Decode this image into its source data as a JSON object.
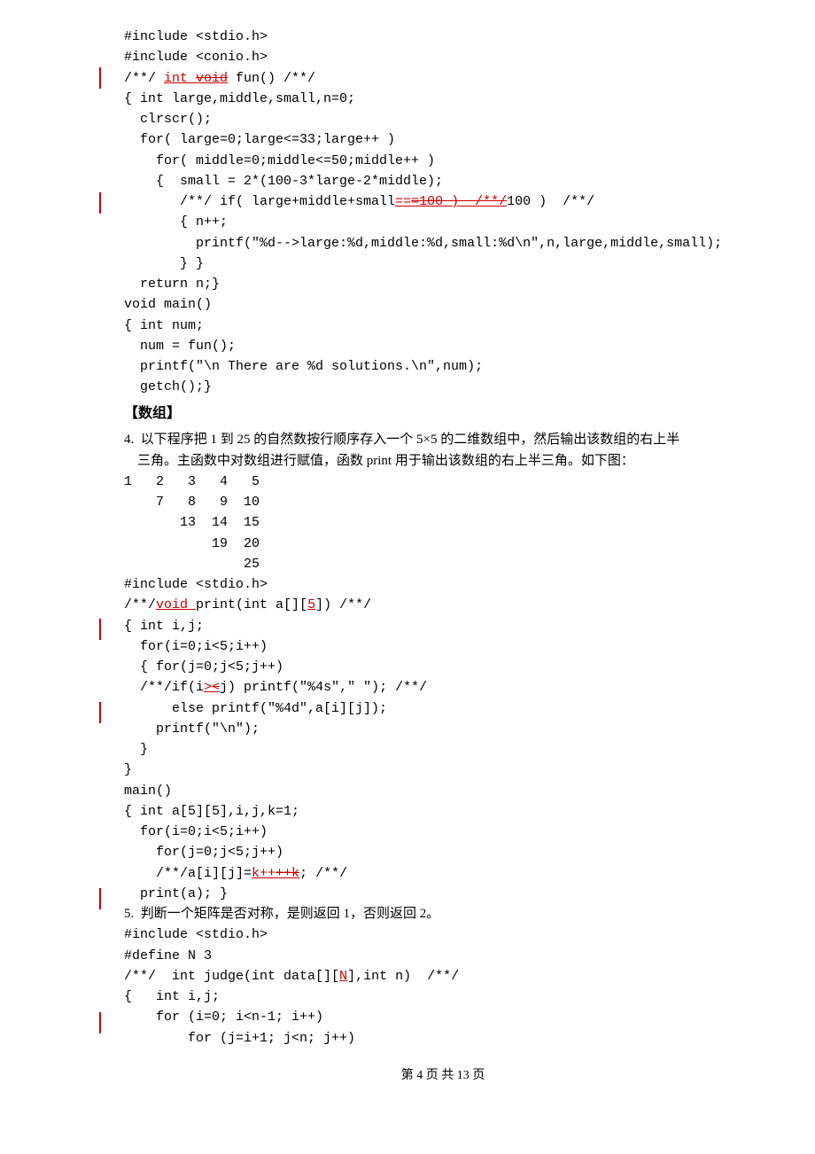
{
  "code1": {
    "l1": "#include <stdio.h>",
    "l2": "#include <conio.h>",
    "l3a": "/**/ ",
    "l3b": "int ",
    "l3c": "void",
    "l3d": " fun() /**/",
    "l4": "{ int large,middle,small,n=0;",
    "l5": "  clrscr();",
    "l6": "  for( large=0;large<=33;large++ )",
    "l7": "    for( middle=0;middle<=50;middle++ )",
    "l8": "    {  small = 2*(100-3*large-2*middle);",
    "l9a": "       /**/ if( large+middle+small",
    "l9b": "==",
    "l9c": "=100 )  /**/",
    "l10": "       { n++;",
    "l11": "         printf(\"%d-->large:%d,middle:%d,small:%d\\n\",n,large,middle,small);",
    "l12": "       } }",
    "l13": "  return n;}",
    "l14": "void main()",
    "l15": "{ int num;",
    "l16": "  num = fun();",
    "l17": "  printf(\"\\n There are %d solutions.\\n\",num);",
    "l18": "  getch();}"
  },
  "section_heading": "【数组】",
  "q4": {
    "line1": "4.  以下程序把 1 到 25 的自然数按行顺序存入一个 5×5 的二维数组中，然后输出该数组的右上半",
    "line2": "    三角。主函数中对数组进行赋值，函数 print 用于输出该数组的右上半三角。如下图：",
    "tri1": "1   2   3   4   5",
    "tri2": "    7   8   9  10",
    "tri3": "       13  14  15",
    "tri4": "           19  20",
    "tri5": "               25"
  },
  "code2": {
    "l1": "#include <stdio.h>",
    "l2a": "/**/",
    "l2b": "void ",
    "l2c": "print(int a[][",
    "l2d": "5",
    "l2e": "]) /**/",
    "l3": "{ int i,j;",
    "l4": "  for(i=0;i<5;i++)",
    "l5": "  { for(j=0;j<5;j++)",
    "l6a": "  /**/if(i",
    "l6b": ">",
    "l6c": "<",
    "l6d": "j) printf(\"%4s\",\" \"); /**/",
    "l7": "      else printf(\"%4d\",a[i][j]);",
    "l8": "    printf(\"\\n\");",
    "l9": "  }",
    "l10": "}",
    "l11": "main()",
    "l12": "{ int a[5][5],i,j,k=1;",
    "l13": "  for(i=0;i<5;i++)",
    "l14": "    for(j=0;j<5;j++)",
    "l15a": "    /**/a[i][j]=",
    "l15b": "k++",
    "l15c": "++k",
    "l15d": "; /**/",
    "l16": "  print(a); }"
  },
  "q5": "5.  判断一个矩阵是否对称，是则返回 1，否则返回 2。",
  "code3": {
    "l1": "#include <stdio.h>",
    "l2": "#define N 3",
    "l3a": "/**/  int judge(int data[][",
    "l3b": "N",
    "l3c": "],int n)  /**/",
    "l4": "{   int i,j;",
    "l5": "    for (i=0; i<n-1; i++)",
    "l6": "        for (j=i+1; j<n; j++)"
  },
  "footer": "第 4 页 共 13 页"
}
